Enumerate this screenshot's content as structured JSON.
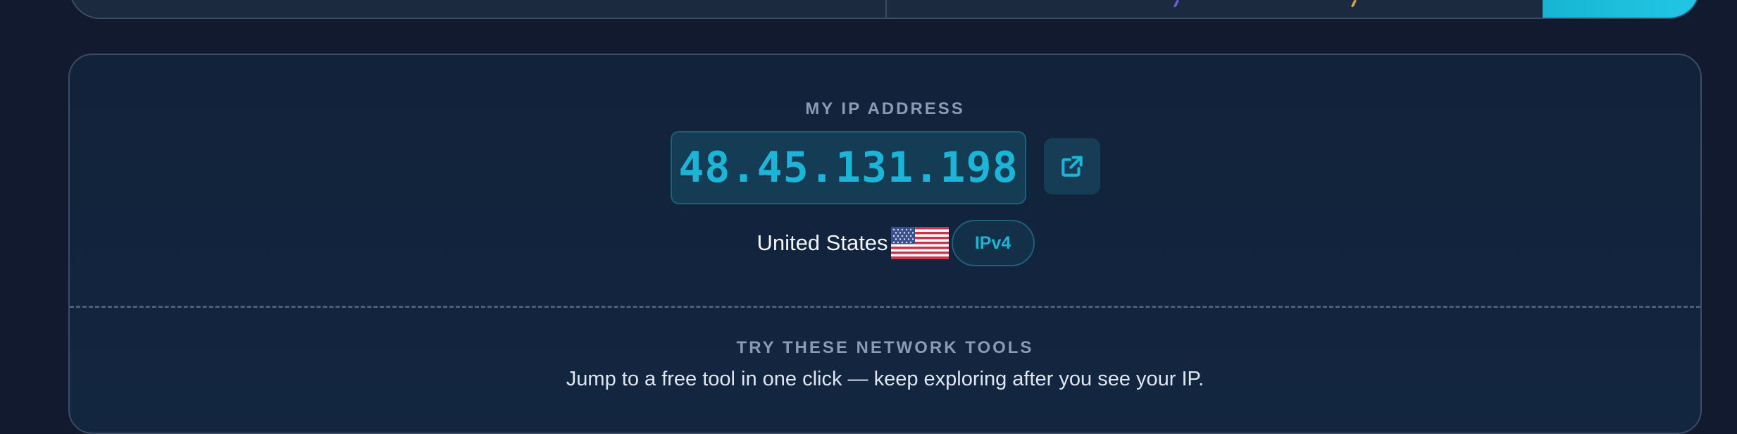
{
  "ip_card": {
    "label": "MY IP ADDRESS",
    "ip_address": "48.45.131.198",
    "country": "United States",
    "ip_version": "IPv4"
  },
  "tools_section": {
    "title": "TRY THESE NETWORK TOOLS",
    "subtitle": "Jump to a free tool in one click — keep exploring after you see your IP."
  },
  "icons": {
    "open_link": "external-link-icon",
    "flag": "us-flag-icon"
  },
  "colors": {
    "page_background": "#111a2e",
    "card_background": "#12223a",
    "accent": "#1cb5d8",
    "muted_text": "#8a9bb6",
    "border": "#3a4c66"
  }
}
